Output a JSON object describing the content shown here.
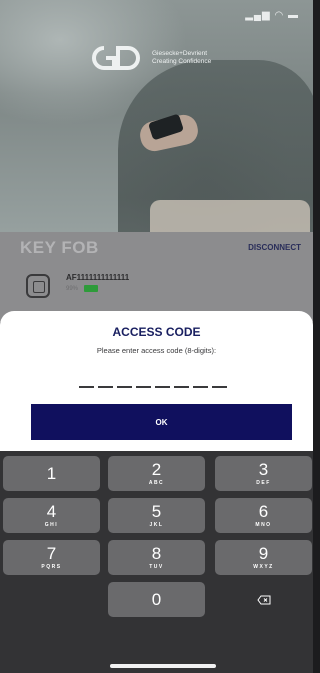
{
  "hero": {
    "brand_line1": "Giesecke+Devrient",
    "brand_line2": "Creating Confidence",
    "status_icons": "signal-icon wifi-icon battery-icon"
  },
  "keyfob": {
    "title": "KEY FOB",
    "disconnect_label": "DISCONNECT",
    "device_id": "AF1111111111111",
    "battery_percent": "99%"
  },
  "dialog": {
    "title": "ACCESS CODE",
    "subtitle": "Please enter access code (8-digits):",
    "ok_label": "OK",
    "code_length": 8
  },
  "keypad": {
    "keys": [
      {
        "num": "1",
        "letters": ""
      },
      {
        "num": "2",
        "letters": "ABC"
      },
      {
        "num": "3",
        "letters": "DEF"
      },
      {
        "num": "4",
        "letters": "GHI"
      },
      {
        "num": "5",
        "letters": "JKL"
      },
      {
        "num": "6",
        "letters": "MNO"
      },
      {
        "num": "7",
        "letters": "PQRS"
      },
      {
        "num": "8",
        "letters": "TUV"
      },
      {
        "num": "9",
        "letters": "WXYZ"
      },
      {
        "num": "0",
        "letters": ""
      }
    ]
  },
  "colors": {
    "brand_navy": "#10105e",
    "battery_green": "#2e9b3a",
    "keypad_bg": "#333335",
    "key_bg": "#6a6a6c"
  }
}
